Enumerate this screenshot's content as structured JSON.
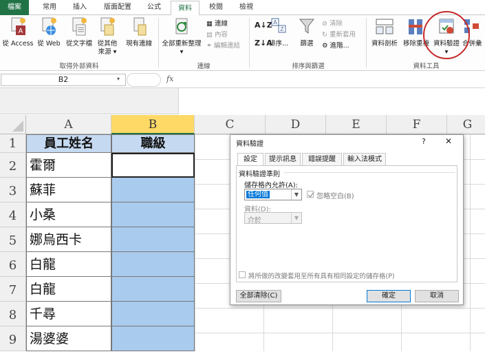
{
  "ribbon_tabs": {
    "file": "檔案",
    "home": "常用",
    "insert": "插入",
    "layout": "版面配置",
    "formulas": "公式",
    "data": "資料",
    "review": "校閱",
    "view": "檢視"
  },
  "ribbon": {
    "external": {
      "access": "從 Access",
      "web": "從 Web",
      "text": "從文字檔",
      "other_line1": "從其他",
      "other_line2": "來源",
      "existing": "現有連線",
      "group": "取得外部資料"
    },
    "connections": {
      "refresh_line1": "全部重新整理",
      "connections": "連線",
      "properties": "內容",
      "edit_links": "編輯連結",
      "group": "連線"
    },
    "sort": {
      "sort": "排序...",
      "filter": "篩選",
      "clear": "清除",
      "reapply": "重新套用",
      "advanced": "進階...",
      "group": "排序與篩選"
    },
    "tools": {
      "text_to_columns": "資料剖析",
      "remove_duplicates": "移除重複",
      "data_validation": "資料驗證",
      "consolidate": "合併彙",
      "group": "資料工具"
    }
  },
  "namebox": "B2",
  "formula_fx": "fx",
  "columns": [
    "A",
    "B",
    "C",
    "D",
    "E",
    "F",
    "G"
  ],
  "rows": [
    "1",
    "2",
    "3",
    "4",
    "5",
    "6",
    "7",
    "8",
    "9"
  ],
  "sheet": {
    "header_a": "員工姓名",
    "header_b": "職級",
    "names": [
      "霍爾",
      "蘇菲",
      "小桑",
      "娜烏西卡",
      "白龍",
      "白龍",
      "千尋",
      "湯婆婆"
    ]
  },
  "dialog": {
    "title": "資料驗證",
    "help": "?",
    "close": "✕",
    "tabs": [
      "設定",
      "提示訊息",
      "錯誤提醒",
      "輸入法模式"
    ],
    "criteria_legend": "資料驗證準則",
    "allow_label": "儲存格內允許(A):",
    "allow_value": "任何值",
    "ignore_blank": "忽略空白(B)",
    "data_label": "資料(D):",
    "data_value": "介於",
    "apply_all": "將所做的改變套用至所有具有相同設定的儲存格(P)",
    "clear_all": "全部清除(C)",
    "ok": "確定",
    "cancel": "取消"
  },
  "colors": {
    "excel_green": "#217346",
    "header_fill": "#c5d9f1",
    "selection_fill": "#a9cbee",
    "highlight_circle": "#c62828"
  }
}
